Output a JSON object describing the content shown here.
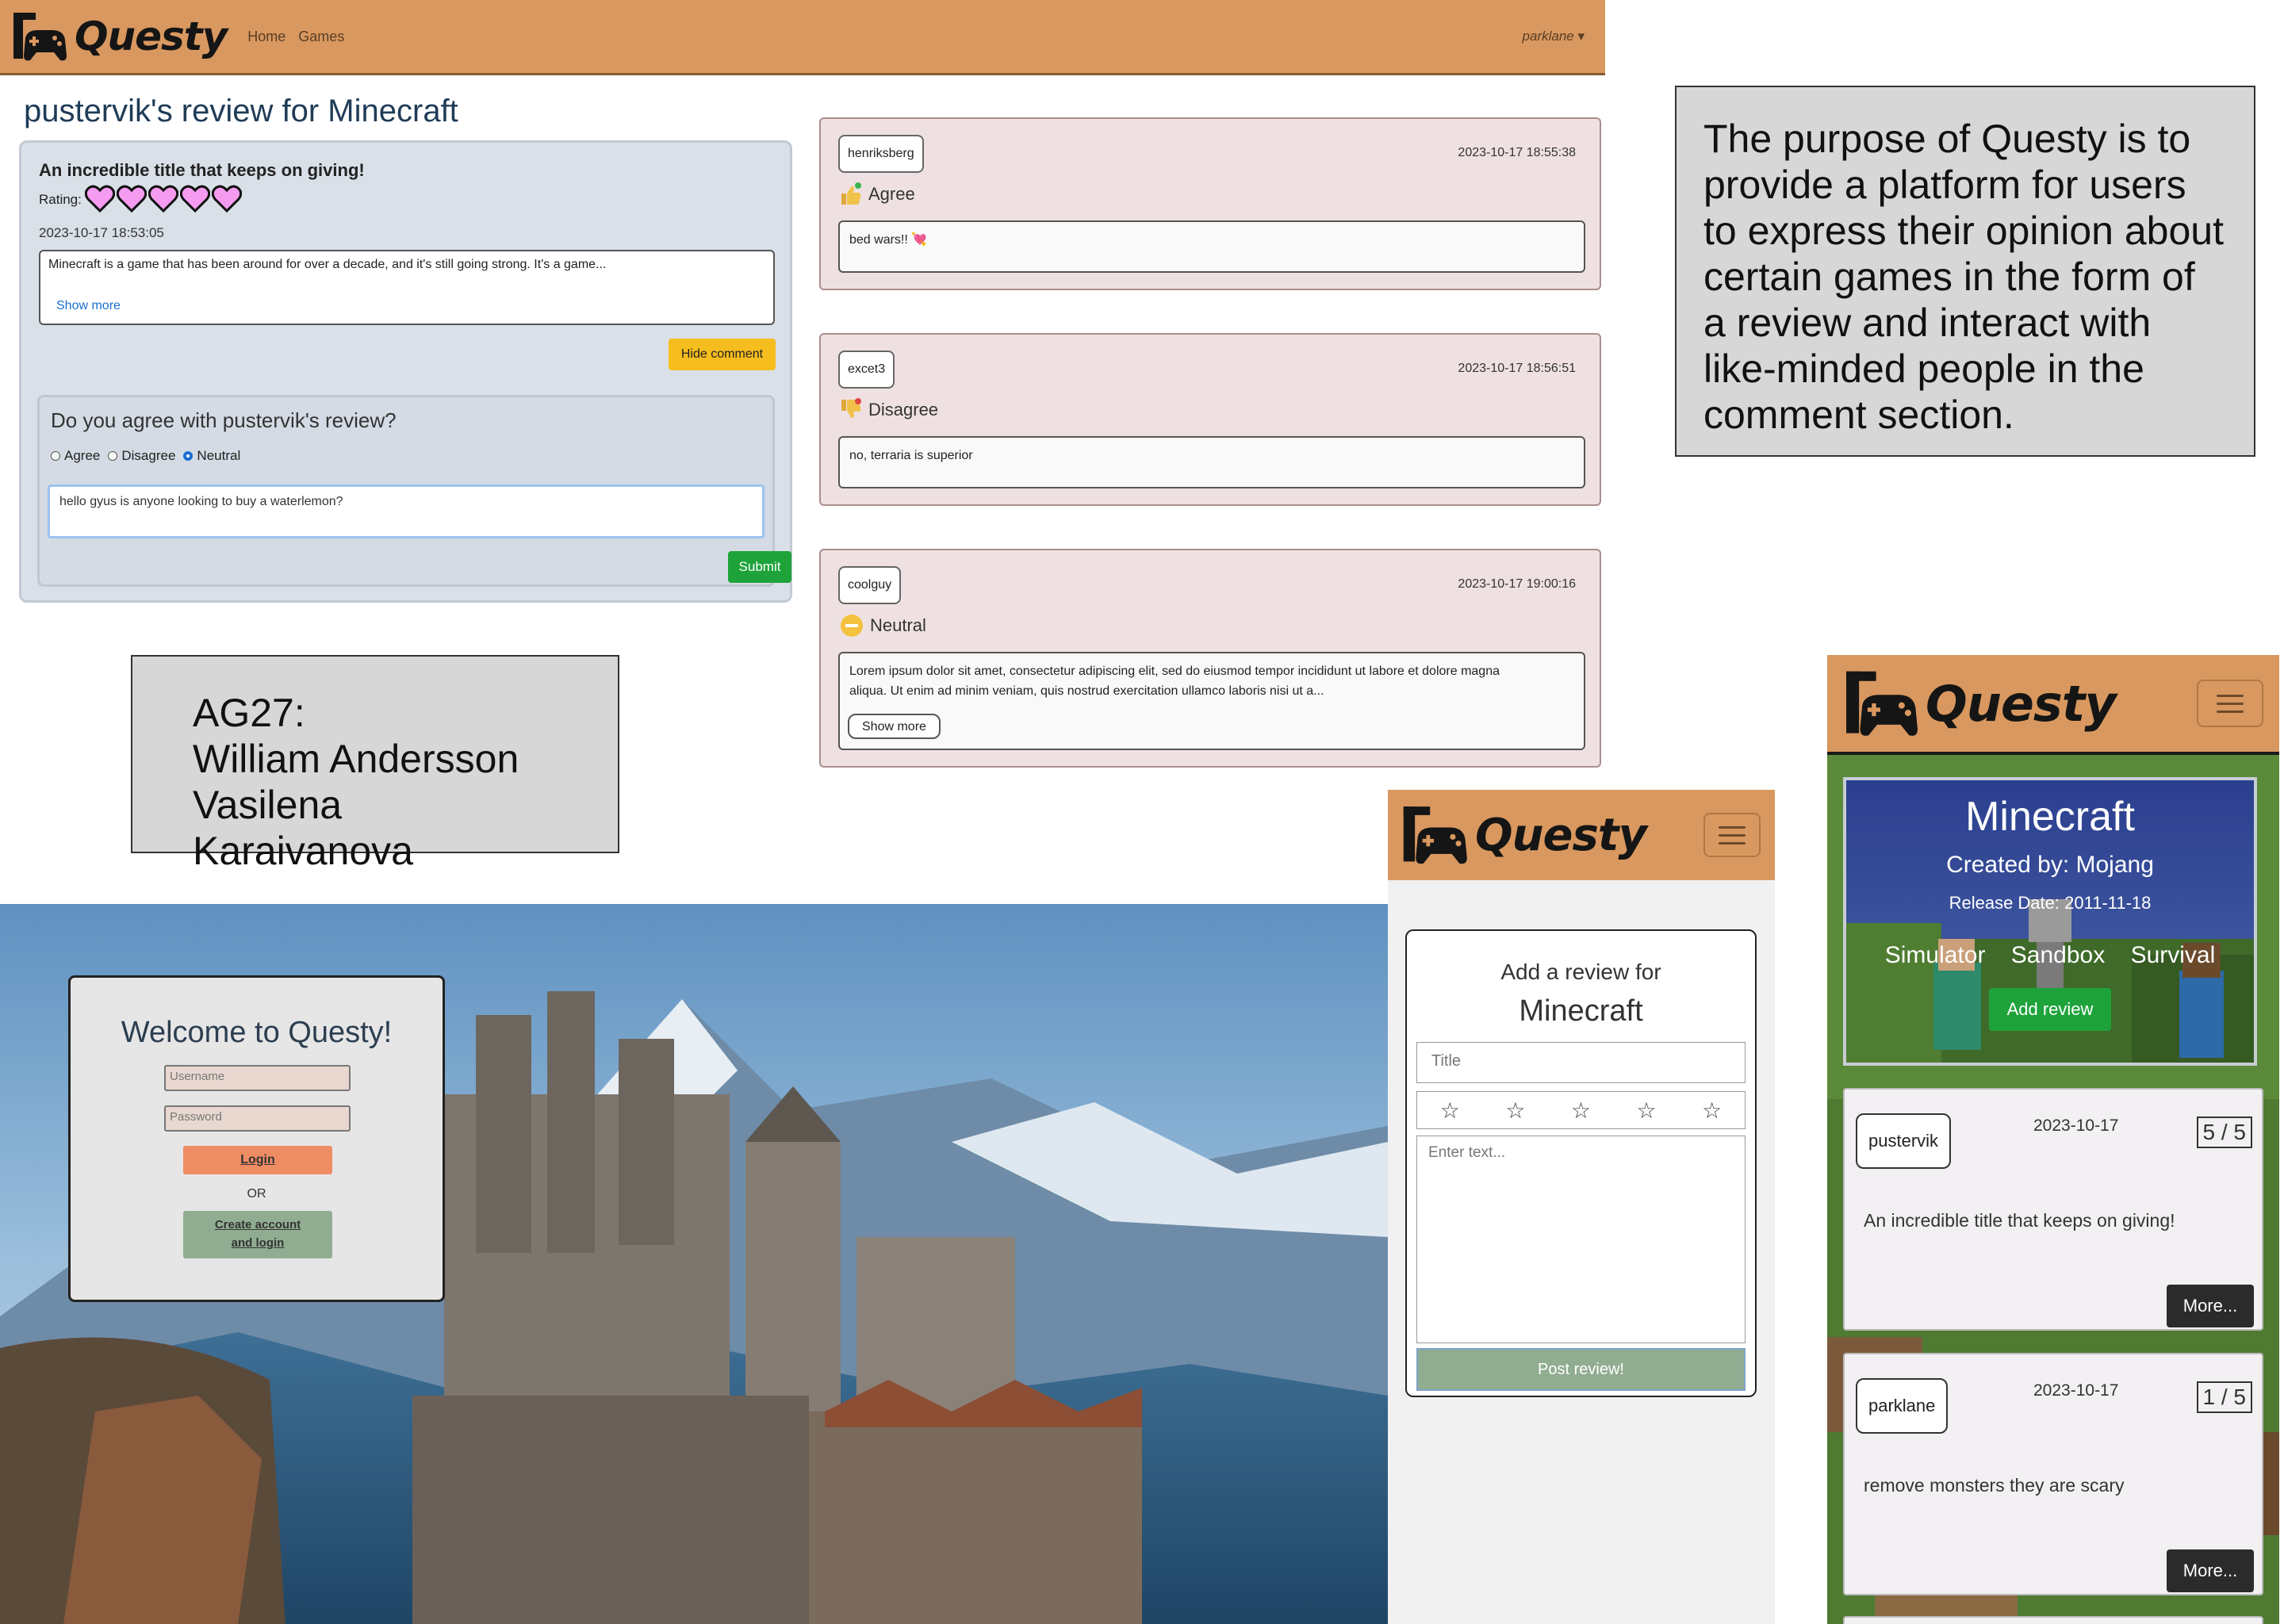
{
  "navbar": {
    "brand": "Questy",
    "links": [
      "Home",
      "Games"
    ],
    "user": "parklane ▾"
  },
  "review_page": {
    "page_title": "pustervik's review for Minecraft",
    "review": {
      "title": "An incredible title that keeps on giving!",
      "rating_label": "Rating:",
      "rating": 5,
      "rating_max": 5,
      "date": "2023-10-17 18:53:05",
      "text": "Minecraft is a game that has been around for over a decade, and it's still going strong. It's a game...",
      "show_more": "Show more",
      "hide_comment": "Hide comment"
    },
    "agree_form": {
      "question": "Do you agree with pustervik's review?",
      "options": [
        "Agree",
        "Disagree",
        "Neutral"
      ],
      "selected": "Neutral",
      "input_value": "hello gyus is anyone looking to buy a waterlemon?",
      "submit": "Submit"
    },
    "comments": [
      {
        "user": "henriksberg",
        "date": "2023-10-17 18:55:38",
        "stance": "Agree",
        "text": "bed wars!! 💘"
      },
      {
        "user": "excet3",
        "date": "2023-10-17 18:56:51",
        "stance": "Disagree",
        "text": "no, terraria is superior"
      },
      {
        "user": "coolguy",
        "date": "2023-10-17 19:00:16",
        "stance": "Neutral",
        "text_line1": "Lorem ipsum dolor sit amet, consectetur adipiscing elit, sed do eiusmod tempor incididunt ut labore et dolore magna",
        "text_line2": "aliqua. Ut enim ad minim veniam, quis nostrud exercitation ullamco laboris nisi ut a...",
        "show_more": "Show more"
      }
    ]
  },
  "info": {
    "purpose": "The purpose of Questy is to provide a platform for users to express their opinion about certain games in the form of a review and interact with like-minded people in the comment section.",
    "credits": {
      "line1": "AG27:",
      "line2": "William Andersson",
      "line3": "Vasilena Karaivanova"
    }
  },
  "login": {
    "welcome": "Welcome to Questy!",
    "username_placeholder": "Username",
    "password_placeholder": "Password",
    "login_button": "Login",
    "or": "OR",
    "create_line1": "Create account",
    "create_line2": "and login"
  },
  "add_review": {
    "brand": "Questy",
    "heading": "Add a review for",
    "game": "Minecraft",
    "title_placeholder": "Title",
    "stars": [
      "☆",
      "☆",
      "☆",
      "☆",
      "☆"
    ],
    "text_placeholder": "Enter text...",
    "post_button": "Post review!"
  },
  "game_page": {
    "brand": "Questy",
    "title": "Minecraft",
    "created_by": "Created by: Mojang",
    "release": "Release Date: 2011-11-18",
    "genres": [
      "Simulator",
      "Sandbox",
      "Survival"
    ],
    "add_review": "Add review",
    "reviews": [
      {
        "user": "pustervik",
        "date": "2023-10-17",
        "score": "5 / 5",
        "title": "An incredible title that keeps on giving!",
        "more": "More..."
      },
      {
        "user": "parklane",
        "date": "2023-10-17",
        "score": "1 / 5",
        "title": "remove monsters they are scary",
        "more": "More..."
      }
    ]
  },
  "colors": {
    "navbar": "#d9985f",
    "accent_green": "#1ea33b",
    "accent_yellow": "#f6bd1e",
    "heart": "#f59bf0"
  }
}
